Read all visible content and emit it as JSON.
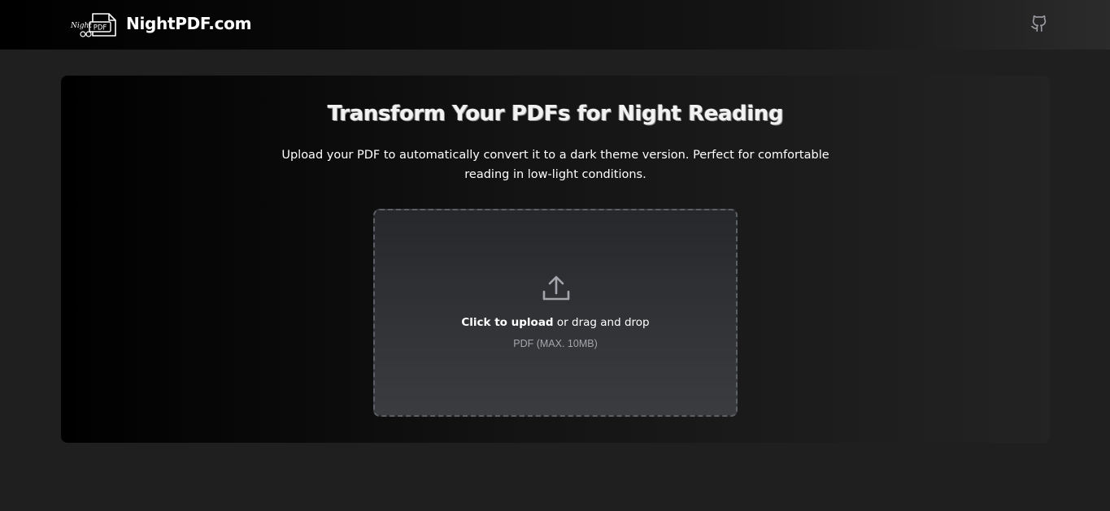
{
  "header": {
    "logo_text_night": "Night",
    "logo_text_pdf": "PDF",
    "brand_name": "NightPDF.com",
    "github_icon": "github-icon"
  },
  "main": {
    "title": "Transform Your PDFs for Night Reading",
    "description": "Upload your PDF to automatically convert it to a dark theme version. Perfect for comfortable reading in low-light conditions."
  },
  "upload": {
    "icon": "upload-icon",
    "click_label": "Click to upload",
    "drag_label": " or drag and drop",
    "hint": "PDF (MAX. 10MB)"
  },
  "colors": {
    "page_background": "#1f1f1f",
    "dropzone_border": "#5c5f66",
    "hint_text": "#a3a6ad"
  }
}
